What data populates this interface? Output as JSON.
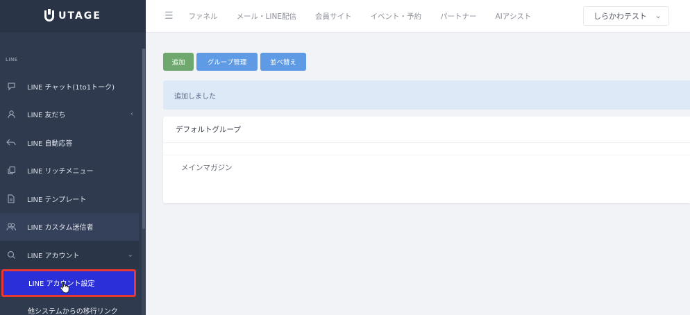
{
  "app": {
    "logo_text": "UTAGE"
  },
  "topbar": {
    "menu_icon": "hamburger-icon",
    "links": [
      "ファネル",
      "メール・LINE配信",
      "会員サイト",
      "イベント・予約",
      "パートナー",
      "AIアシスト"
    ],
    "user_name": "しらかわテスト"
  },
  "sidebar": {
    "section_label": "LINE",
    "items": [
      {
        "label": "LINE チャット(1to1トーク)",
        "icon": "chat-icon"
      },
      {
        "label": "LINE 友だち",
        "icon": "user-icon"
      },
      {
        "label": "LINE 自動応答",
        "icon": "reply-icon"
      },
      {
        "label": "LINE リッチメニュー",
        "icon": "copy-icon"
      },
      {
        "label": "LINE テンプレート",
        "icon": "document-icon"
      },
      {
        "label": "LINE カスタム送信者",
        "icon": "users-icon"
      },
      {
        "label": "LINE アカウント",
        "icon": "search-icon"
      }
    ],
    "sub_items": [
      {
        "label": "LINE アカウント設定"
      },
      {
        "label": "他システムからの移行リンク"
      }
    ]
  },
  "main": {
    "buttons": {
      "add": "追加",
      "group_manage": "グループ管理",
      "sort": "並べ替え"
    },
    "alert": "追加しました",
    "group": {
      "name": "デフォルトグループ",
      "rows": [
        "メインマガジン"
      ]
    }
  },
  "colors": {
    "sidebar_bg": "#2f3a4f",
    "active_item": "#2a2fd8",
    "highlight_border": "#e83a30",
    "btn_green": "#6fa86f",
    "btn_blue": "#5f9ae4",
    "alert_bg": "#dde9f7"
  }
}
